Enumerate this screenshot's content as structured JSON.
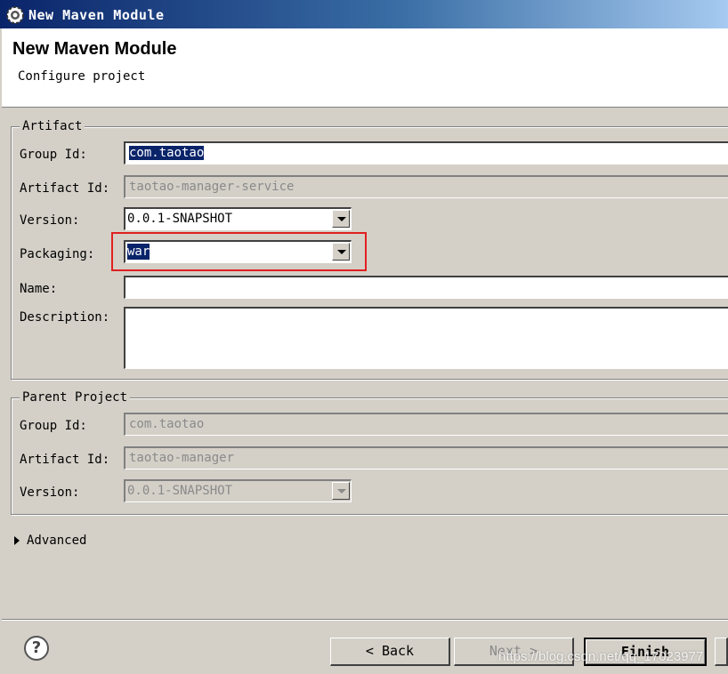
{
  "window": {
    "title": "New Maven Module"
  },
  "header": {
    "title": "New Maven Module",
    "subtitle": "Configure project"
  },
  "artifact": {
    "legend": "Artifact",
    "group_id_label": "Group Id:",
    "group_id_value": "com.taotao",
    "artifact_id_label": "Artifact Id:",
    "artifact_id_value": "taotao-manager-service",
    "version_label": "Version:",
    "version_value": "0.0.1-SNAPSHOT",
    "packaging_label": "Packaging:",
    "packaging_value": "war",
    "name_label": "Name:",
    "name_value": "",
    "description_label": "Description:",
    "description_value": ""
  },
  "parent": {
    "legend": "Parent Project",
    "group_id_label": "Group Id:",
    "group_id_value": "com.taotao",
    "artifact_id_label": "Artifact Id:",
    "artifact_id_value": "taotao-manager",
    "version_label": "Version:",
    "version_value": "0.0.1-SNAPSHOT"
  },
  "advanced": {
    "label": "Advanced"
  },
  "footer": {
    "help_symbol": "?",
    "back_label": "< Back",
    "next_label": "Next >",
    "finish_label": "Finish"
  },
  "watermark": "https://blog.csdn.net/qq_17023977",
  "colors": {
    "highlight": "#e02020",
    "selection": "#0a246a",
    "title_bar": "#0a246a"
  },
  "icons": {
    "app": "eclipse-gear-icon",
    "help": "help-icon",
    "dropdown": "chevron-down-icon",
    "advanced": "triangle-right-icon"
  }
}
